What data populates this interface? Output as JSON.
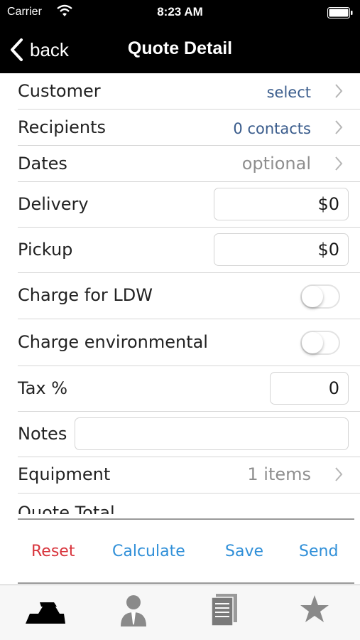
{
  "status_bar": {
    "carrier": "Carrier",
    "time": "8:23 AM"
  },
  "nav": {
    "back_label": "back",
    "title": "Quote Detail"
  },
  "form": {
    "customer": {
      "label": "Customer",
      "value": "select"
    },
    "recipients": {
      "label": "Recipients",
      "value": "0 contacts"
    },
    "dates": {
      "label": "Dates",
      "value": "optional"
    },
    "delivery": {
      "label": "Delivery",
      "value": "$0"
    },
    "pickup": {
      "label": "Pickup",
      "value": "$0"
    },
    "charge_ldw": {
      "label": "Charge for LDW",
      "on": false
    },
    "charge_env": {
      "label": "Charge environmental",
      "on": false
    },
    "tax": {
      "label": "Tax %",
      "value": "0"
    },
    "notes": {
      "label": "Notes",
      "value": ""
    },
    "equipment": {
      "label": "Equipment",
      "value": "1 items"
    },
    "quote_total": {
      "label": "Quote Total"
    }
  },
  "actions": {
    "reset": "Reset",
    "calculate": "Calculate",
    "save": "Save",
    "send": "Send"
  },
  "colors": {
    "reset": "#d8343c",
    "action_blue": "#2f8fd8",
    "link_blue": "#3a5c8c"
  },
  "tabs": [
    {
      "icon": "equipment-icon",
      "selected": true
    },
    {
      "icon": "person-icon",
      "selected": false
    },
    {
      "icon": "documents-icon",
      "selected": false
    },
    {
      "icon": "star-icon",
      "selected": false
    }
  ]
}
